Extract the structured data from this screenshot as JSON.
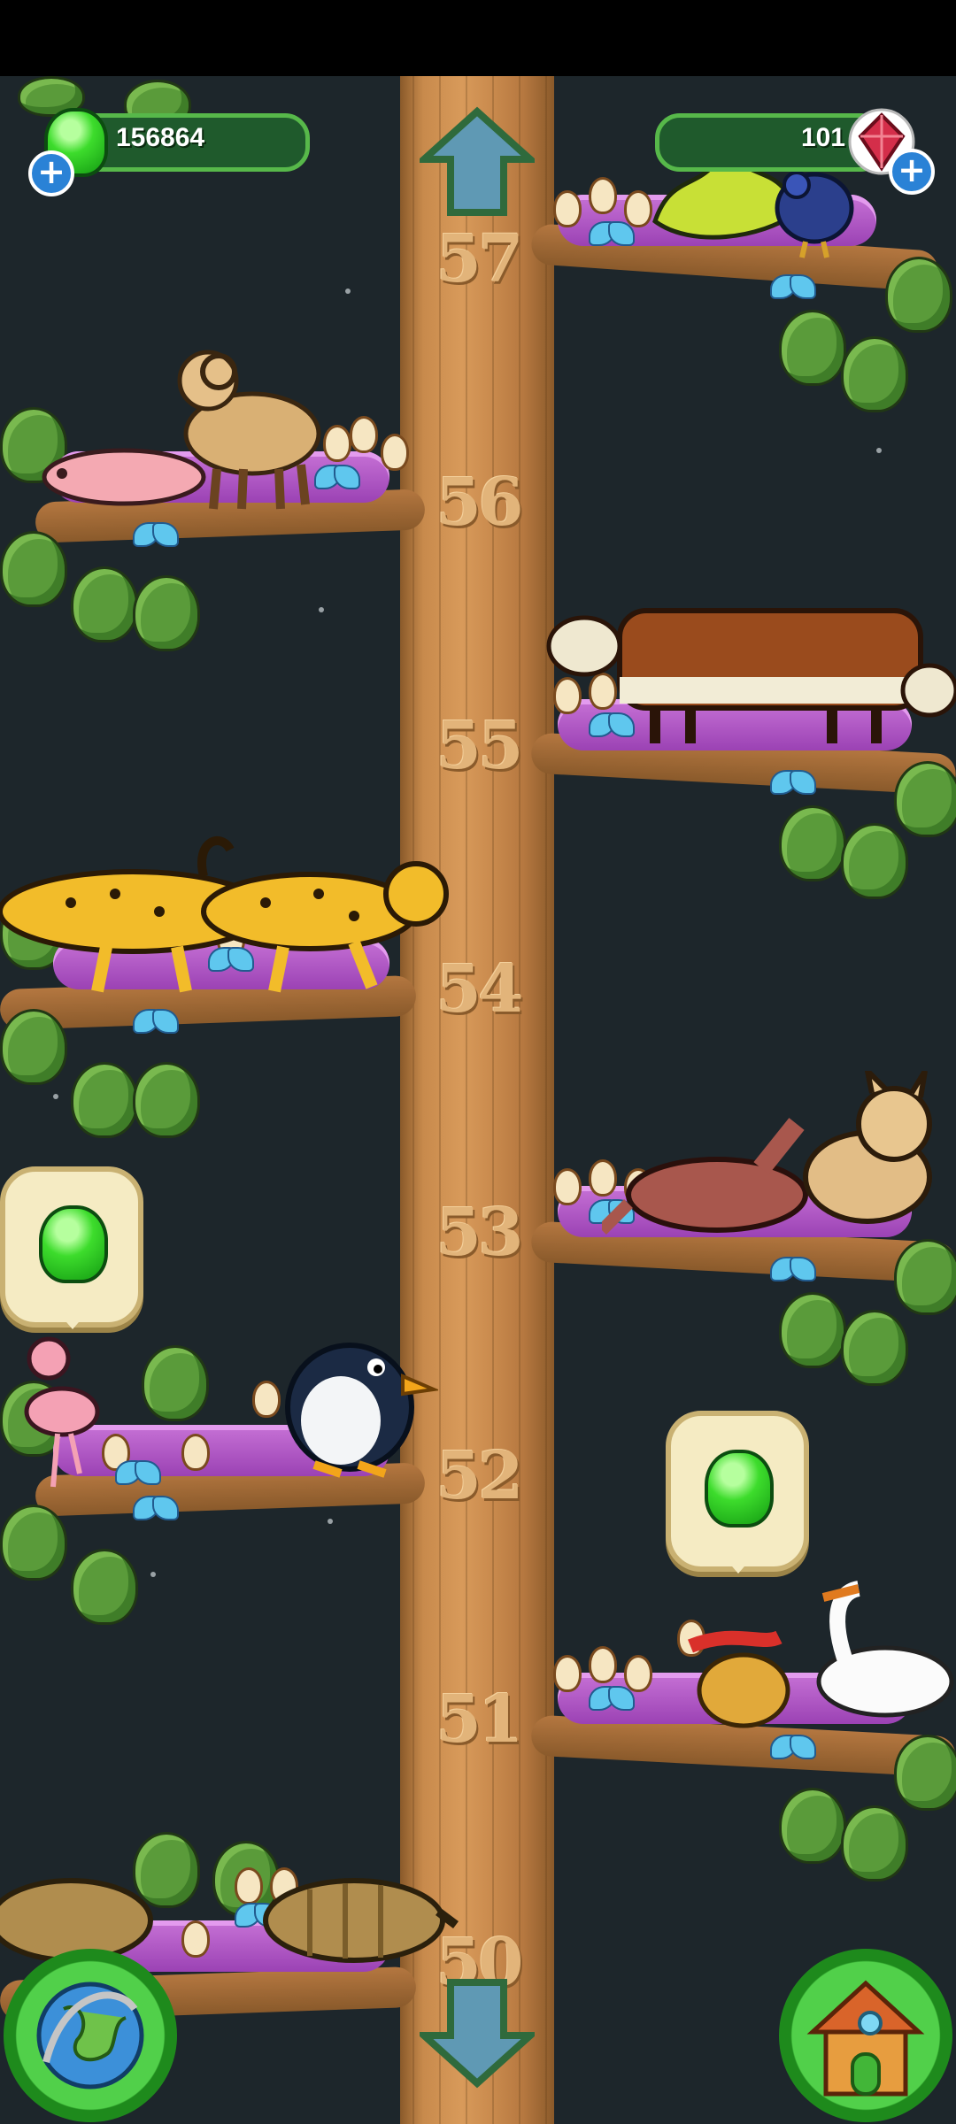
{
  "hud": {
    "gems_value": "156864",
    "rubies_value": "101",
    "gems_plus": "+",
    "rubies_plus": "+"
  },
  "tree": {
    "levels": [
      "57",
      "56",
      "55",
      "54",
      "53",
      "52",
      "51",
      "50"
    ]
  },
  "colors": {
    "trunk": "#c88a4c",
    "leaf": "#5a9b3a",
    "nest": "#c772d6",
    "gem": "#3ddc2c",
    "background": "#1d262b"
  },
  "animals": {
    "level_57": [
      "dragon-plant-icon",
      "peacock-icon"
    ],
    "level_56": [
      "mole-rat-icon",
      "ram-camel-icon"
    ],
    "level_55": [
      "cow-icon"
    ],
    "level_54": [
      "cheetah-icon"
    ],
    "level_53": [
      "anteater-icon",
      "lynx-icon"
    ],
    "level_52": [
      "flamingo-icon",
      "penguin-icon"
    ],
    "level_51": [
      "rabbit-icon",
      "swan-icon"
    ],
    "level_50": [
      "armadillo-icon"
    ]
  },
  "icons": {
    "up_arrow": "up-arrow-icon",
    "down_arrow": "down-arrow-icon",
    "globe": "globe-icon",
    "house": "house-icon",
    "gem": "green-gem-icon",
    "ruby": "ruby-icon"
  }
}
